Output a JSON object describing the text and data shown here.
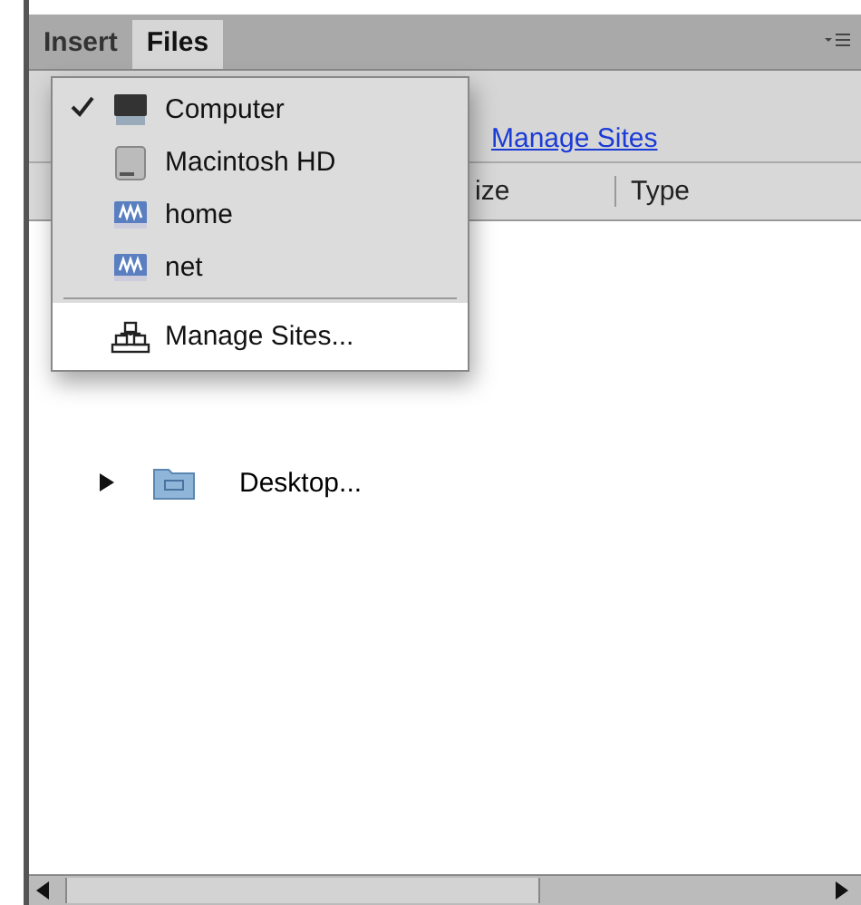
{
  "tabs": [
    {
      "label": "Insert",
      "selected": false
    },
    {
      "label": "Files",
      "selected": true
    }
  ],
  "toolbar": {
    "link": "Manage Sites"
  },
  "columns": [
    "ize",
    "Type"
  ],
  "tree": [
    {
      "label": "Desktop...",
      "expanded": false
    }
  ],
  "menu": {
    "items": [
      {
        "label": "Computer",
        "kind": "computer",
        "checked": true,
        "selected": false
      },
      {
        "label": "Macintosh HD",
        "kind": "disk",
        "checked": false,
        "selected": false
      },
      {
        "label": "home",
        "kind": "network",
        "checked": false,
        "selected": false
      },
      {
        "label": "net",
        "kind": "network",
        "checked": false,
        "selected": false
      },
      {
        "label": "Manage Sites...",
        "kind": "sites",
        "checked": false,
        "selected": true
      }
    ]
  }
}
